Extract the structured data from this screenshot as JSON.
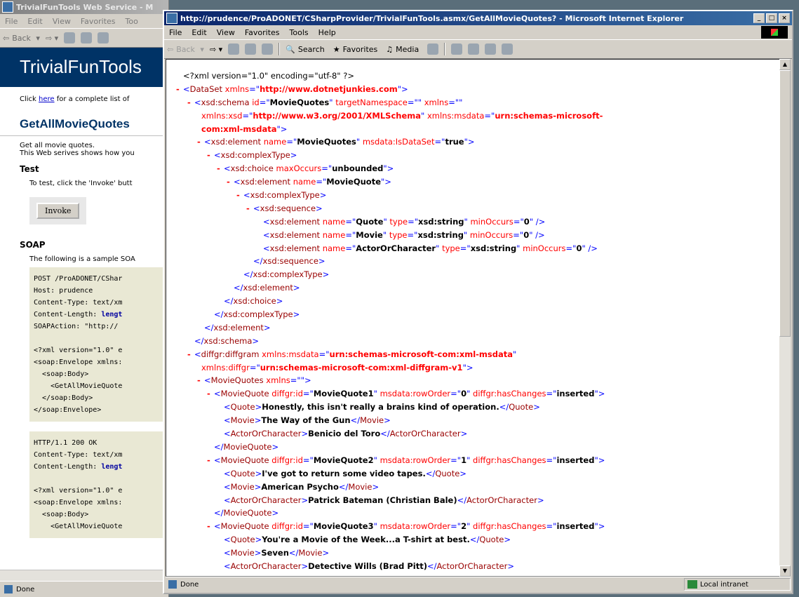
{
  "bg": {
    "title": "TrivialFunTools Web Service - M",
    "menu": [
      "File",
      "Edit",
      "View",
      "Favorites",
      "Too"
    ],
    "back_label": "Back",
    "banner": "TrivialFunTools",
    "click_prefix": "Click ",
    "click_link": "here",
    "click_suffix": " for a complete list of",
    "operation": "GetAllMovieQuotes",
    "desc1": "Get all movie quotes.",
    "desc2": "This Web serives shows how you",
    "test_heading": "Test",
    "test_text": "To test, click the 'Invoke' butt",
    "invoke": "Invoke",
    "soap_heading": "SOAP",
    "soap_text": "The following is a sample SOA",
    "request_lines": [
      "POST /ProADONET/CShar",
      "Host: prudence",
      "Content-Type: text/xm",
      "Content-Length: ",
      "SOAPAction: \"http://",
      "",
      "<?xml version=\"1.0\" e",
      "<soap:Envelope xmlns:",
      "  <soap:Body>",
      "    <GetAllMovieQuote",
      "  </soap:Body>",
      "</soap:Envelope>"
    ],
    "request_bold": "lengt",
    "response_lines": [
      "HTTP/1.1 200 OK",
      "Content-Type: text/xm",
      "Content-Length: ",
      "",
      "<?xml version=\"1.0\" e",
      "<soap:Envelope xmlns:",
      "  <soap:Body>",
      "    <GetAllMovieQuote"
    ],
    "status": "Done"
  },
  "fg": {
    "title": "http://prudence/ProADONET/CSharpProvider/TrivialFunTools.asmx/GetAllMovieQuotes? - Microsoft Internet Explorer",
    "menu": [
      "File",
      "Edit",
      "View",
      "Favorites",
      "Tools",
      "Help"
    ],
    "toolbar": {
      "back": "Back",
      "search": "Search",
      "favorites": "Favorites",
      "media": "Media"
    },
    "status": "Done",
    "zone": "Local intranet"
  },
  "xml": {
    "decl": "<?xml version=\"1.0\" encoding=\"utf-8\" ?>",
    "dataset_ns": "http://www.dotnetjunkies.com",
    "schema_id": "MovieQuotes",
    "schema_tns": "",
    "schema_xmlns": "",
    "xsd_ns": "http://www.w3.org/2001/XMLSchema",
    "msdata_ns_a": "urn:schemas-microsoft-",
    "msdata_ns_b": "com:xml-msdata",
    "root_element": "MovieQuotes",
    "is_dataset": "true",
    "max_occurs": "unbounded",
    "row_element": "MovieQuote",
    "fields": [
      {
        "name": "Quote",
        "type": "xsd:string",
        "min": "0"
      },
      {
        "name": "Movie",
        "type": "xsd:string",
        "min": "0"
      },
      {
        "name": "ActorOrCharacter",
        "type": "xsd:string",
        "min": "0"
      }
    ],
    "diffgram_msdata": "urn:schemas-microsoft-com:xml-msdata",
    "diffgram_ns": "urn:schemas-microsoft-com:xml-diffgram-v1",
    "quotes_xmlns": "",
    "has_changes": "inserted",
    "records": [
      {
        "id": "MovieQuote1",
        "order": "0",
        "quote": "Honestly, this isn't really a brains kind of operation.",
        "movie": "The Way of the Gun",
        "actor": "Benicio del Toro"
      },
      {
        "id": "MovieQuote2",
        "order": "1",
        "quote": "I've got to return some video tapes.",
        "movie": "American Psycho",
        "actor": "Patrick Bateman (Christian Bale)"
      },
      {
        "id": "MovieQuote3",
        "order": "2",
        "quote": "You're a Movie of the Week...a T-shirt at best.",
        "movie": "Seven",
        "actor": "Detective Wills (Brad Pitt)"
      }
    ]
  }
}
